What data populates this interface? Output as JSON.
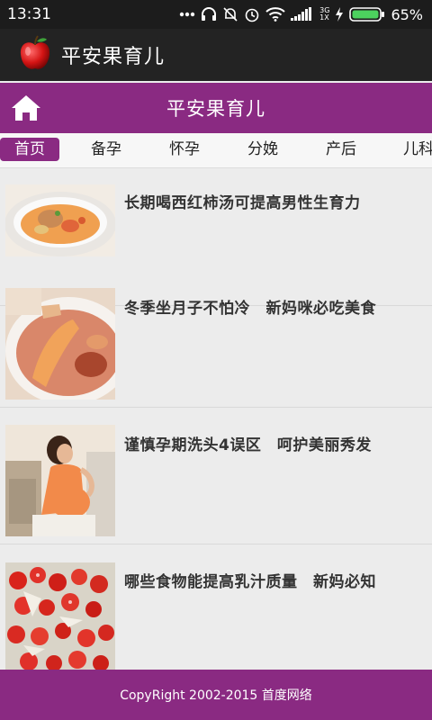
{
  "status_bar": {
    "time": "13:31",
    "network_3g": "3G",
    "network_1x": "1X",
    "battery": "65%",
    "icons": [
      "more-dots-icon",
      "headphones-icon",
      "mute-icon",
      "alarm-icon",
      "wifi-icon",
      "signal-icon",
      "charging-icon",
      "battery-icon"
    ]
  },
  "app_bar": {
    "title": "平安果育儿",
    "logo_icon": "apple-logo"
  },
  "header": {
    "title": "平安果育儿",
    "home_icon": "home-icon"
  },
  "tabs": [
    {
      "label": "首页",
      "active": true
    },
    {
      "label": "备孕"
    },
    {
      "label": "怀孕"
    },
    {
      "label": "分娩"
    },
    {
      "label": "产后"
    },
    {
      "label": "儿科"
    }
  ],
  "articles": [
    {
      "title": "长期喝西红柿汤可提高男性生育力",
      "thumbnail": "tomato-soup-photo"
    },
    {
      "title": "冬季坐月子不怕冷　新妈咪必吃美食",
      "thumbnail": "braised-dish-photo"
    },
    {
      "title": "谨慎孕期洗头4误区　呵护美丽秀发",
      "thumbnail": "pregnant-woman-photo"
    },
    {
      "title": "哪些食物能提高乳汁质量　新妈必知",
      "thumbnail": "cherry-tomato-salad-photo"
    }
  ],
  "footer": {
    "copyright": "CopyRight 2002-2015 首度网络"
  },
  "colors": {
    "brand": "#8a2a82",
    "status_bar": "#1c1c1c",
    "app_bar": "#232323",
    "background": "#ececec"
  }
}
